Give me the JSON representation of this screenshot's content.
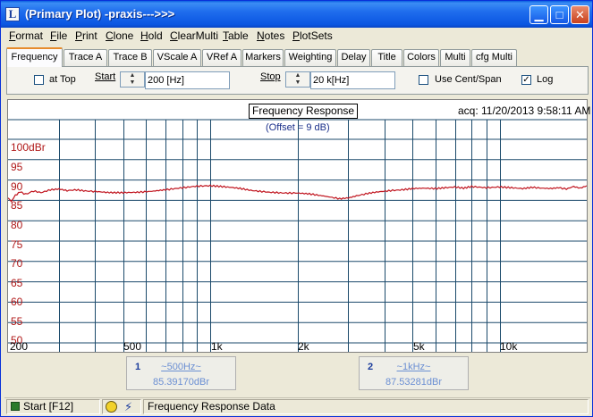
{
  "window": {
    "title": "(Primary Plot) -praxis--->>>"
  },
  "menu": [
    {
      "label": "Format",
      "u": "F",
      "rest": "ormat"
    },
    {
      "label": "File",
      "u": "F",
      "rest": "ile"
    },
    {
      "label": "Print",
      "u": "P",
      "rest": "rint"
    },
    {
      "label": "Clone",
      "u": "C",
      "rest": "lone"
    },
    {
      "label": "Hold",
      "u": "H",
      "rest": "old"
    },
    {
      "label": "ClearMulti",
      "u": "C",
      "rest": "learMulti"
    },
    {
      "label": "Table",
      "u": "T",
      "rest": "able"
    },
    {
      "label": "Notes",
      "u": "N",
      "rest": "otes"
    },
    {
      "label": "PlotSets",
      "u": "P",
      "rest": "lotSets"
    }
  ],
  "tabs": [
    "Frequency",
    "Trace A",
    "Trace B",
    "VScale A",
    "VRef A",
    "Markers",
    "Weighting",
    "Delay",
    "Title",
    "Colors",
    "Multi",
    "cfg Multi"
  ],
  "controls": {
    "at_top": "at Top",
    "start_label": "Start",
    "start_value": "200 [Hz]",
    "stop_label": "Stop",
    "stop_value": "20 k[Hz]",
    "cent_span": "Use Cent/Span",
    "log_label": "Log",
    "log_checked": "✓"
  },
  "plot": {
    "title": "Frequency Response",
    "acq": "acq: 11/20/2013 9:58:11 AM",
    "offset": "(Offset = 9 dB)",
    "trace_color": "#c0141e",
    "grid_color": "#1b4a6b"
  },
  "chart_data": {
    "type": "line",
    "title": "Frequency Response",
    "xscale": "log",
    "xlim": [
      200,
      20000
    ],
    "ylim": [
      50,
      100
    ],
    "y_unit": "dBr",
    "y_ticks": [
      "100dBr",
      "95",
      "90",
      "85",
      "80",
      "75",
      "70",
      "65",
      "60",
      "55",
      "50"
    ],
    "x_ticks": [
      "200",
      "500",
      "1k",
      "2k",
      "5k",
      "10k"
    ],
    "series": [
      {
        "x": [
          200,
          205,
          212,
          220,
          230,
          245,
          260,
          280,
          300,
          320,
          345,
          370,
          400,
          430,
          460,
          500,
          560,
          620,
          700,
          800,
          900,
          1000,
          1100,
          1250,
          1400,
          1600,
          1800,
          2000,
          2200,
          2400,
          2600,
          2800,
          3000,
          3200,
          3500,
          3800,
          4200,
          4600,
          5000,
          5500,
          6000,
          6500,
          7000,
          7500,
          8000,
          9000,
          10000,
          11000,
          12000,
          13000,
          14000,
          15000,
          16000,
          17000,
          18000,
          19000,
          20000
        ],
        "y": [
          85.6,
          84.8,
          86.2,
          87.1,
          86.5,
          87.3,
          86.9,
          87.6,
          87.8,
          87.4,
          87.6,
          87.3,
          87.2,
          87.0,
          86.9,
          86.9,
          87.0,
          87.2,
          87.6,
          88.1,
          88.5,
          88.6,
          88.4,
          88.0,
          87.4,
          87.0,
          86.8,
          86.8,
          86.6,
          86.2,
          85.8,
          85.4,
          85.6,
          86.1,
          86.7,
          87.1,
          87.4,
          87.6,
          87.9,
          88.0,
          87.9,
          88.1,
          88.3,
          88.0,
          88.4,
          88.1,
          88.3,
          88.1,
          87.9,
          88.2,
          88.0,
          87.9,
          88.1,
          87.8,
          88.4,
          88.0,
          88.6
        ]
      }
    ]
  },
  "markers": [
    {
      "num": "1",
      "freq": "~500Hz~",
      "value": "85.39170dBr"
    },
    {
      "num": "2",
      "freq": "~1kHz~",
      "value": "87.53281dBr"
    }
  ],
  "status": {
    "start": "Start [F12]",
    "message": "Frequency Response Data"
  }
}
